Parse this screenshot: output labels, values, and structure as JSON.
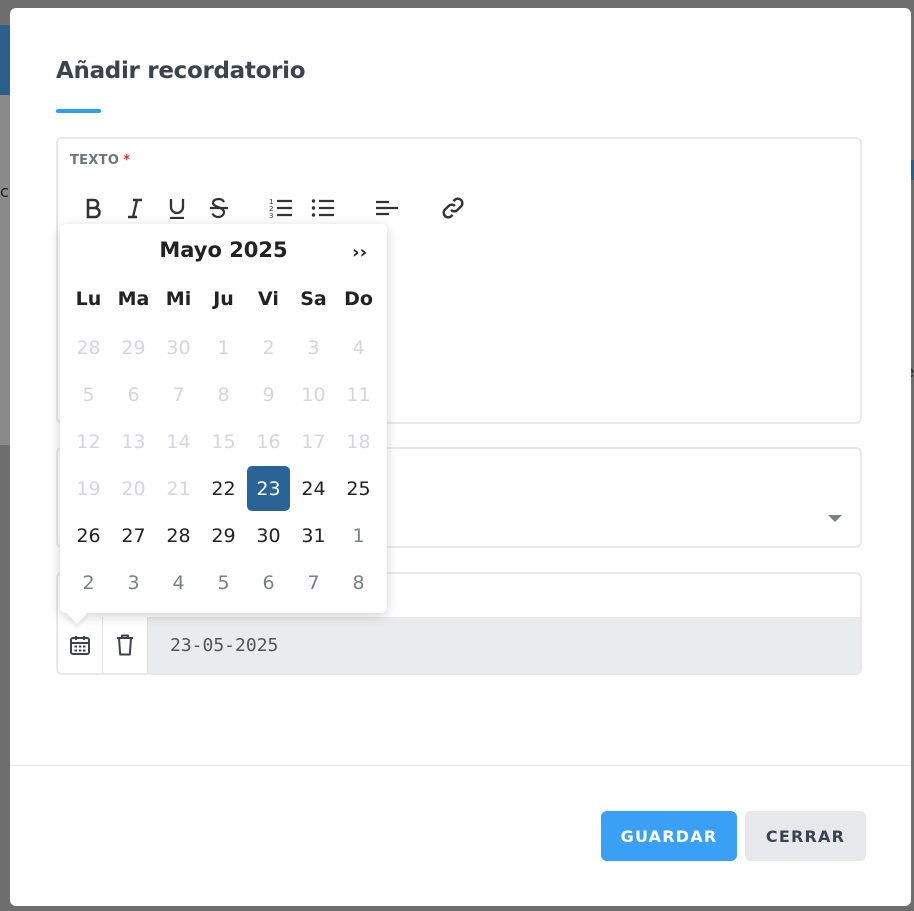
{
  "modal": {
    "title": "Añadir recordatorio",
    "text_field": {
      "label": "TEXTO",
      "required_mark": "*"
    },
    "toolbar": [
      {
        "name": "bold-icon",
        "glyph": "B"
      },
      {
        "name": "italic-icon",
        "glyph": "I"
      },
      {
        "name": "underline-icon",
        "glyph": "U"
      },
      {
        "name": "strikethrough-icon",
        "glyph": "S"
      },
      {
        "name": "ordered-list-icon",
        "glyph": "ol"
      },
      {
        "name": "bullet-list-icon",
        "glyph": "ul"
      },
      {
        "name": "align-left-icon",
        "glyph": "al"
      },
      {
        "name": "link-icon",
        "glyph": "link"
      }
    ],
    "date_field": {
      "value": "23-05-2025"
    },
    "buttons": {
      "save": "GUARDAR",
      "close": "CERRAR"
    }
  },
  "datepicker": {
    "month_label": "Mayo 2025",
    "next": "››",
    "weekdays": [
      "Lu",
      "Ma",
      "Mi",
      "Ju",
      "Vi",
      "Sa",
      "Do"
    ],
    "days": [
      {
        "d": "28",
        "s": "muted"
      },
      {
        "d": "29",
        "s": "muted"
      },
      {
        "d": "30",
        "s": "muted"
      },
      {
        "d": "1",
        "s": "muted"
      },
      {
        "d": "2",
        "s": "muted"
      },
      {
        "d": "3",
        "s": "muted"
      },
      {
        "d": "4",
        "s": "muted"
      },
      {
        "d": "5",
        "s": "muted"
      },
      {
        "d": "6",
        "s": "muted"
      },
      {
        "d": "7",
        "s": "muted"
      },
      {
        "d": "8",
        "s": "muted"
      },
      {
        "d": "9",
        "s": "muted"
      },
      {
        "d": "10",
        "s": "muted"
      },
      {
        "d": "11",
        "s": "muted"
      },
      {
        "d": "12",
        "s": "muted"
      },
      {
        "d": "13",
        "s": "muted"
      },
      {
        "d": "14",
        "s": "muted"
      },
      {
        "d": "15",
        "s": "muted"
      },
      {
        "d": "16",
        "s": "muted"
      },
      {
        "d": "17",
        "s": "muted"
      },
      {
        "d": "18",
        "s": "muted"
      },
      {
        "d": "19",
        "s": "muted"
      },
      {
        "d": "20",
        "s": "muted"
      },
      {
        "d": "21",
        "s": "muted"
      },
      {
        "d": "22",
        "s": "active"
      },
      {
        "d": "23",
        "s": "selected"
      },
      {
        "d": "24",
        "s": "active"
      },
      {
        "d": "25",
        "s": "active"
      },
      {
        "d": "26",
        "s": "active"
      },
      {
        "d": "27",
        "s": "active"
      },
      {
        "d": "28",
        "s": "active"
      },
      {
        "d": "29",
        "s": "active"
      },
      {
        "d": "30",
        "s": "active"
      },
      {
        "d": "31",
        "s": "active"
      },
      {
        "d": "1",
        "s": "other"
      },
      {
        "d": "2",
        "s": "other"
      },
      {
        "d": "3",
        "s": "other"
      },
      {
        "d": "4",
        "s": "other"
      },
      {
        "d": "5",
        "s": "other"
      },
      {
        "d": "6",
        "s": "other"
      },
      {
        "d": "7",
        "s": "other"
      },
      {
        "d": "8",
        "s": "other"
      }
    ]
  },
  "colors": {
    "accent": "#3aa0f5",
    "selected_day": "#2a6496",
    "required": "#e03131"
  }
}
